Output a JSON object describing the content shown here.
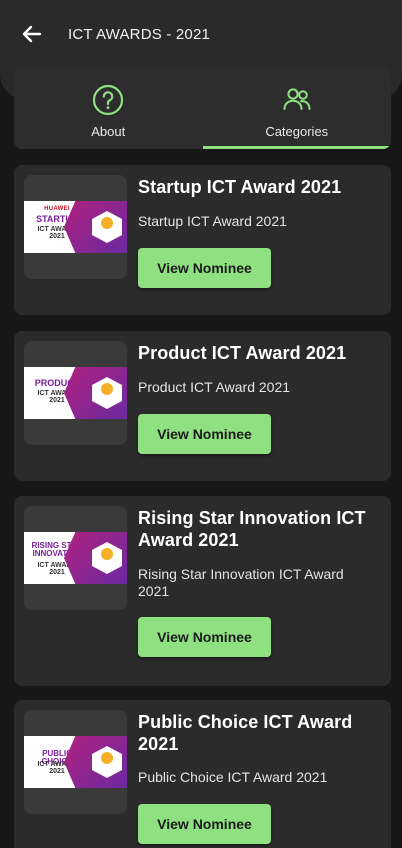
{
  "header": {
    "title": "ICT AWARDS - 2021",
    "back_icon": "arrow-left-icon"
  },
  "tabs": [
    {
      "label": "About",
      "icon": "question-circle-icon",
      "active": false
    },
    {
      "label": "Categories",
      "icon": "users-icon",
      "active": true
    }
  ],
  "accent_color": "#8fe080",
  "categories": [
    {
      "title": "Startup ICT Award 2021",
      "description": "Startup ICT Award 2021",
      "button": "View Nominee",
      "banner": {
        "brand": "HUAWEI",
        "main": "STARTUP",
        "sub": "ICT AWARD 2021"
      }
    },
    {
      "title": "Product ICT Award 2021",
      "description": "Product ICT Award 2021",
      "button": "View Nominee",
      "banner": {
        "main": "PRODUCT",
        "sub": "ICT AWARD 2021"
      }
    },
    {
      "title": "Rising Star Innovation ICT Award 2021",
      "description": "Rising Star Innovation ICT Award 2021",
      "button": "View Nominee",
      "banner": {
        "main": "RISING STAR INNOVATION",
        "sub": "ICT AWARD 2021"
      }
    },
    {
      "title": "Public Choice ICT Award 2021",
      "description": "Public Choice ICT Award 2021",
      "button": "View Nominee",
      "banner": {
        "main": "PUBLIC CHOICE",
        "sub": "ICT AWARD 2021"
      }
    }
  ]
}
